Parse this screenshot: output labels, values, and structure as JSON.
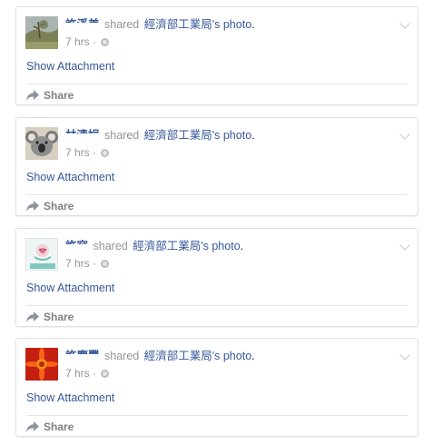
{
  "posts": [
    {
      "author": "許溪美",
      "shared_text": "shared",
      "page": "經濟部工業局",
      "possessive": "'s",
      "object": "photo",
      "period": ".",
      "time": "7 hrs",
      "sep": "·",
      "attachment_label": "Show Attachment",
      "share_label": "Share",
      "avatar": "landscape-avatar"
    },
    {
      "author": "林清娟",
      "shared_text": "shared",
      "page": "經濟部工業局",
      "possessive": "'s",
      "object": "photo",
      "period": ".",
      "time": "7 hrs",
      "sep": "·",
      "attachment_label": "Show Attachment",
      "share_label": "Share",
      "avatar": "koala-avatar"
    },
    {
      "author": "許容",
      "shared_text": "shared",
      "page": "經濟部工業局",
      "possessive": "'s",
      "object": "photo",
      "period": ".",
      "time": "7 hrs",
      "sep": "·",
      "attachment_label": "Show Attachment",
      "share_label": "Share",
      "avatar": "cartoon-avatar"
    },
    {
      "author": "許慶豐",
      "shared_text": "shared",
      "page": "經濟部工業局",
      "possessive": "'s",
      "object": "photo",
      "period": ".",
      "time": "7 hrs",
      "sep": "·",
      "attachment_label": "Show Attachment",
      "share_label": "Share",
      "avatar": "red-flower-avatar"
    }
  ],
  "colors": {
    "link": "#365899",
    "muted": "#90949c",
    "share": "#7f7f7f",
    "border": "#dddfe2"
  }
}
